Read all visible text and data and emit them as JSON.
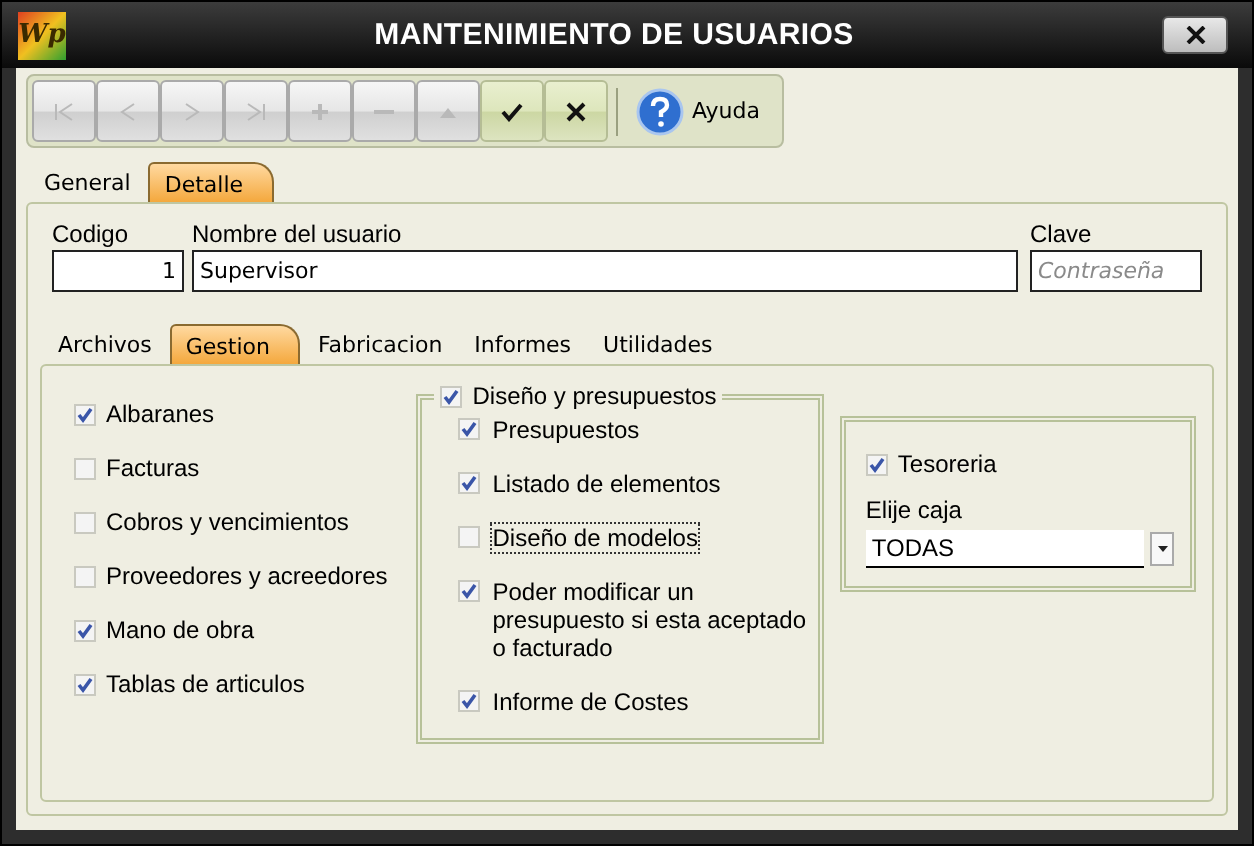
{
  "window": {
    "logo": "Wp",
    "title": "MANTENIMIENTO DE USUARIOS"
  },
  "toolbar": [
    {
      "kind": "first",
      "disabled": true
    },
    {
      "kind": "prev",
      "disabled": true
    },
    {
      "kind": "next",
      "disabled": true
    },
    {
      "kind": "last",
      "disabled": true
    },
    {
      "kind": "add",
      "disabled": true
    },
    {
      "kind": "remove",
      "disabled": true
    },
    {
      "kind": "edit",
      "disabled": true
    },
    {
      "kind": "accept",
      "disabled": false
    },
    {
      "kind": "cancel",
      "disabled": false
    },
    {
      "kind": "help",
      "label": "Ayuda",
      "disabled": false
    }
  ],
  "tabs": [
    {
      "label": "General",
      "selected": false
    },
    {
      "label": "Detalle",
      "selected": true
    }
  ],
  "fields": {
    "code": {
      "label": "Codigo",
      "value": "1"
    },
    "name": {
      "label": "Nombre del usuario",
      "value": "Supervisor"
    },
    "password": {
      "label": "Clave",
      "placeholder": "Contraseña"
    }
  },
  "subtabs": [
    {
      "label": "Archivos",
      "selected": false
    },
    {
      "label": "Gestion",
      "selected": true
    },
    {
      "label": "Fabricacion",
      "selected": false
    },
    {
      "label": "Informes",
      "selected": false
    },
    {
      "label": "Utilidades",
      "selected": false
    }
  ],
  "gestion": {
    "left": [
      {
        "label": "Albaranes",
        "checked": true
      },
      {
        "label": "Facturas",
        "checked": false
      },
      {
        "label": "Cobros y vencimientos",
        "checked": false
      },
      {
        "label": "Proveedores y acreedores",
        "checked": false
      },
      {
        "label": "Mano de obra",
        "checked": true
      },
      {
        "label": "Tablas de articulos",
        "checked": true
      }
    ],
    "design_group": {
      "label": "Diseño y presupuestos",
      "checked": true,
      "items": [
        {
          "label": "Presupuestos",
          "checked": true,
          "focused": false
        },
        {
          "label": "Listado de elementos",
          "checked": true,
          "focused": false
        },
        {
          "label": "Diseño de modelos",
          "checked": false,
          "focused": true
        },
        {
          "label": "Poder modificar un presupuesto si esta aceptado o facturado",
          "checked": true,
          "focused": false
        },
        {
          "label": "Informe de Costes",
          "checked": true,
          "focused": false
        }
      ]
    },
    "treasury": {
      "label": "Tesoreria",
      "checked": true,
      "cash_label": "Elije caja",
      "cash_value": "TODAS"
    }
  }
}
